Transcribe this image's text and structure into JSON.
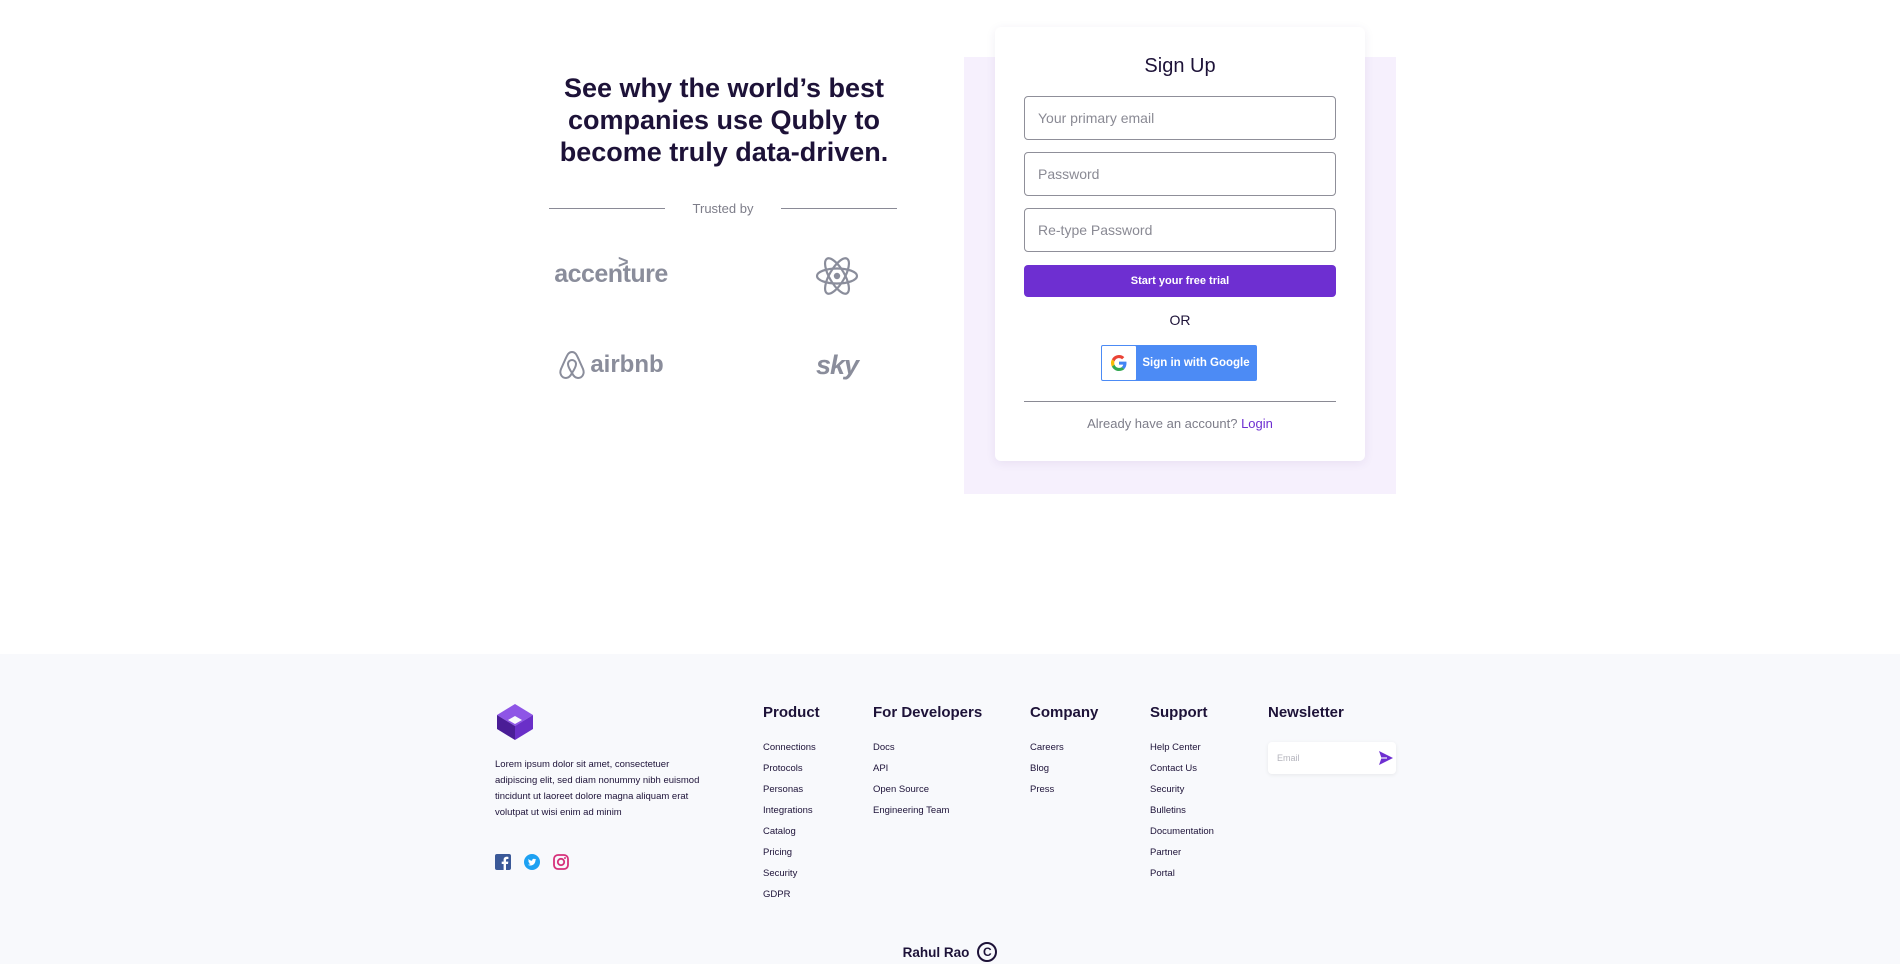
{
  "hero": {
    "title_line1": "See why the world’s best",
    "title_line2": "companies use Qubly to",
    "title_line3": "become truly data-driven.",
    "trusted_label": "Trusted by"
  },
  "logos": {
    "accenture": "accenture",
    "airbnb": "airbnb",
    "sky": "sky"
  },
  "signup": {
    "title": "Sign Up",
    "email_placeholder": "Your primary email",
    "password_placeholder": "Password",
    "retype_placeholder": "Re-type Password",
    "trial_button": "Start your free trial",
    "or_label": "OR",
    "google_button": "Sign in with Google",
    "already_text": "Already have an account?",
    "login_link": "Login"
  },
  "footer": {
    "description": "Lorem ipsum dolor sit amet, consectetuer adipiscing elit, sed diam nonummy nibh euismod tincidunt ut laoreet dolore magna aliquam erat volutpat ut wisi enim ad minim",
    "columns": {
      "product": {
        "title": "Product",
        "items": [
          "Connections",
          "Protocols",
          "Personas",
          "Integrations",
          "Catalog",
          "Pricing",
          "Security",
          "GDPR"
        ]
      },
      "developers": {
        "title": "For Developers",
        "items": [
          "Docs",
          "API",
          "Open Source",
          "Engineering Team"
        ]
      },
      "company": {
        "title": "Company",
        "items": [
          "Careers",
          "Blog",
          "Press"
        ]
      },
      "support": {
        "title": "Support",
        "items": [
          "Help Center",
          "Contact Us",
          "Security",
          "Bulletins",
          "Documentation",
          "Partner",
          "Portal"
        ]
      }
    },
    "newsletter": {
      "title": "Newsletter",
      "placeholder": "Email"
    },
    "credit": "Rahul Rao"
  },
  "colors": {
    "accent": "#6e2fd1",
    "heading": "#1d1238",
    "card_bg": "#f6f0fd",
    "google_blue": "#4c8bf5",
    "footer_bg": "#f8f9fc"
  },
  "icons": {
    "react_logo": "react-atom-icon",
    "airbnb_logo": "airbnb-belo-icon",
    "google": "google-g-icon",
    "facebook": "facebook-icon",
    "twitter": "twitter-icon",
    "instagram": "instagram-icon",
    "send": "send-arrow-icon",
    "copyright": "copyright-icon",
    "brand": "qubly-brand-logo"
  }
}
